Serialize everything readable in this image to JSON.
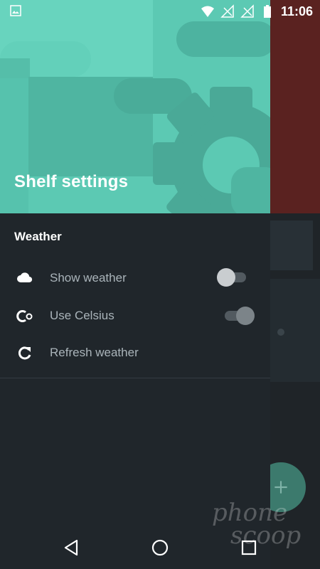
{
  "status_bar": {
    "time": "11:06",
    "icons": [
      "image-icon",
      "wifi-icon",
      "no-signal-icon",
      "no-signal-icon",
      "battery-icon"
    ]
  },
  "drawer": {
    "title": "Shelf settings",
    "section": "Weather",
    "items": [
      {
        "label": "Show weather",
        "icon": "cloud-icon",
        "toggle": false
      },
      {
        "label": "Use Celsius",
        "icon": "celsius-icon",
        "toggle": true
      },
      {
        "label": "Refresh weather",
        "icon": "refresh-icon"
      }
    ]
  },
  "watermark": {
    "line1": "phone",
    "line2": "scoop"
  },
  "colors": {
    "header": "#59c6b0",
    "drawer": "#20262b",
    "accent": "#3c7a6d"
  }
}
